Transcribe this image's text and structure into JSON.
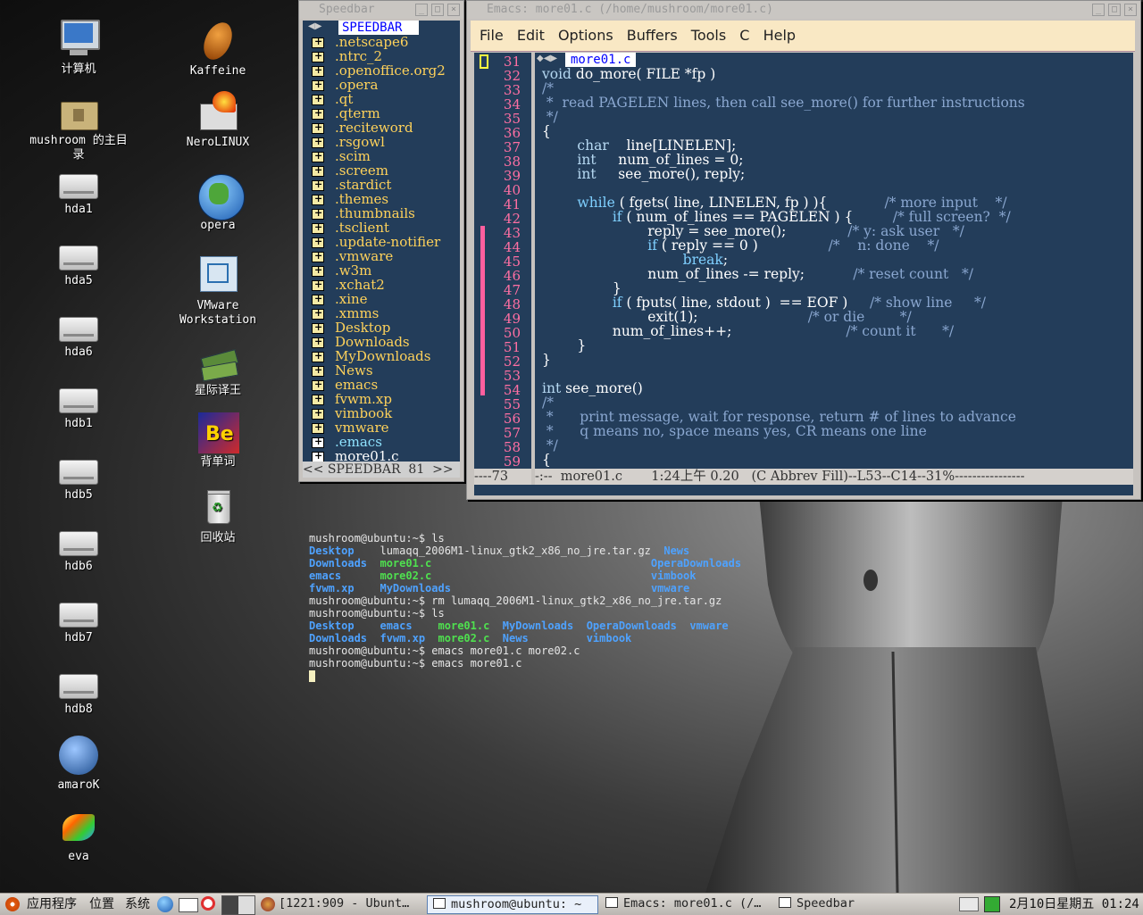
{
  "desktop": {
    "icons": [
      {
        "label": "计算机"
      },
      {
        "label": "Kaffeine"
      },
      {
        "label": "mushroom 的主目录"
      },
      {
        "label": "NeroLINUX"
      },
      {
        "label": "hda1"
      },
      {
        "label": "opera"
      },
      {
        "label": "hda5"
      },
      {
        "label": "VMware Workstation"
      },
      {
        "label": "hda6"
      },
      {
        "label": "星际译王"
      },
      {
        "label": "hdb1"
      },
      {
        "label": "背单词"
      },
      {
        "label": "hdb5"
      },
      {
        "label": "回收站"
      },
      {
        "label": "hdb6"
      },
      {
        "label": "hdb7"
      },
      {
        "label": "hdb8"
      },
      {
        "label": "amaroK"
      },
      {
        "label": "eva"
      }
    ]
  },
  "speedbar": {
    "title": "Speedbar",
    "header": "SPEEDBAR",
    "items": [
      ".netscape6",
      ".ntrc_2",
      ".openoffice.org2",
      ".opera",
      ".qt",
      ".qterm",
      ".reciteword",
      ".rsgowl",
      ".scim",
      ".screem",
      ".stardict",
      ".themes",
      ".thumbnails",
      ".tsclient",
      ".update-notifier",
      ".vmware",
      ".w3m",
      ".xchat2",
      ".xine",
      ".xmms",
      "Desktop",
      "Downloads",
      "MyDownloads",
      "News",
      "emacs",
      "fvwm.xp",
      "vimbook",
      "vmware",
      ".emacs",
      "more01.c"
    ],
    "modeline": "<< SPEEDBAR  81  >>"
  },
  "emacs": {
    "title": "Emacs: more01.c (/home/mushroom/more01.c)",
    "menu": [
      "File",
      "Edit",
      "Options",
      "Buffers",
      "Tools",
      "C",
      "Help"
    ],
    "tab": "more01.c",
    "line_numbers": [
      "31",
      "32",
      "33",
      "34",
      "35",
      "36",
      "37",
      "38",
      "39",
      "40",
      "41",
      "42",
      "43",
      "44",
      "45",
      "46",
      "47",
      "48",
      "49",
      "50",
      "51",
      "52",
      "53",
      "54",
      "55",
      "56",
      "57",
      "58",
      "59"
    ],
    "left_modeline": "----73",
    "modeline": "-:--  more01.c       1:24上午 0.20   (C Abbrev Fill)--L53--C14--31%----------------",
    "code": [
      "void do_more( FILE *fp )",
      "/*",
      " *  read PAGELEN lines, then call see_more() for further instructions",
      " */",
      "{",
      "        char    line[LINELEN];",
      "        int     num_of_lines = 0;",
      "        int     see_more(), reply;",
      "",
      "        while ( fgets( line, LINELEN, fp ) ){             /* more input    */",
      "                if ( num_of_lines == PAGELEN ) {         /* full screen?  */",
      "                        reply = see_more();              /* y: ask user   */",
      "                        if ( reply == 0 )                /*    n: done    */",
      "                                break;",
      "                        num_of_lines -= reply;           /* reset count   */",
      "                }",
      "                if ( fputs( line, stdout )  == EOF )     /* show line     */",
      "                        exit(1);                         /* or die        */",
      "                num_of_lines++;                          /* count it      */",
      "        }",
      "}",
      "",
      "int see_more()",
      "/*",
      " *      print message, wait for response, return # of lines to advance",
      " *      q means no, space means yes, CR means one line",
      " */",
      "{"
    ]
  },
  "terminal": {
    "lines": [
      [
        {
          "t": "mushroom@ubuntu:~$ ls"
        }
      ],
      [
        {
          "t": "Desktop",
          "c": "dir"
        },
        {
          "t": "    lumaqq_2006M1-linux_gtk2_x86_no_jre.tar.gz  "
        },
        {
          "t": "News",
          "c": "dir"
        }
      ],
      [
        {
          "t": "Downloads",
          "c": "dir"
        },
        {
          "t": "  "
        },
        {
          "t": "more01.c",
          "c": "exe"
        },
        {
          "t": "                                  "
        },
        {
          "t": "OperaDownloads",
          "c": "dir"
        }
      ],
      [
        {
          "t": "emacs",
          "c": "dir"
        },
        {
          "t": "      "
        },
        {
          "t": "more02.c",
          "c": "exe"
        },
        {
          "t": "                                  "
        },
        {
          "t": "vimbook",
          "c": "dir"
        }
      ],
      [
        {
          "t": "fvwm.xp",
          "c": "dir"
        },
        {
          "t": "    "
        },
        {
          "t": "MyDownloads",
          "c": "dir"
        },
        {
          "t": "                               "
        },
        {
          "t": "vmware",
          "c": "dir"
        }
      ],
      [
        {
          "t": "mushroom@ubuntu:~$ rm lumaqq_2006M1-linux_gtk2_x86_no_jre.tar.gz"
        }
      ],
      [
        {
          "t": "mushroom@ubuntu:~$ ls"
        }
      ],
      [
        {
          "t": "Desktop",
          "c": "dir"
        },
        {
          "t": "    "
        },
        {
          "t": "emacs",
          "c": "dir"
        },
        {
          "t": "    "
        },
        {
          "t": "more01.c",
          "c": "exe"
        },
        {
          "t": "  "
        },
        {
          "t": "MyDownloads",
          "c": "dir"
        },
        {
          "t": "  "
        },
        {
          "t": "OperaDownloads",
          "c": "dir"
        },
        {
          "t": "  "
        },
        {
          "t": "vmware",
          "c": "dir"
        }
      ],
      [
        {
          "t": "Downloads",
          "c": "dir"
        },
        {
          "t": "  "
        },
        {
          "t": "fvwm.xp",
          "c": "dir"
        },
        {
          "t": "  "
        },
        {
          "t": "more02.c",
          "c": "exe"
        },
        {
          "t": "  "
        },
        {
          "t": "News",
          "c": "dir"
        },
        {
          "t": "         "
        },
        {
          "t": "vimbook",
          "c": "dir"
        }
      ],
      [
        {
          "t": "mushroom@ubuntu:~$ emacs more01.c more02.c"
        }
      ],
      [
        {
          "t": "mushroom@ubuntu:~$ emacs more01.c"
        }
      ]
    ]
  },
  "panel": {
    "apps": "应用程序",
    "places": "位置",
    "system": "系统",
    "tasks": [
      {
        "label": "[1221:909 - Ubunt…"
      },
      {
        "label": "mushroom@ubuntu: ~"
      },
      {
        "label": "Emacs: more01.c (/…"
      },
      {
        "label": "Speedbar"
      }
    ],
    "clock": "2月10日星期五 01:24"
  },
  "colors": {
    "editor_bg": "#233d5a",
    "menubar_bg": "#f9e8c4",
    "dir": "#4ea2ff",
    "exe": "#4fe04f"
  }
}
